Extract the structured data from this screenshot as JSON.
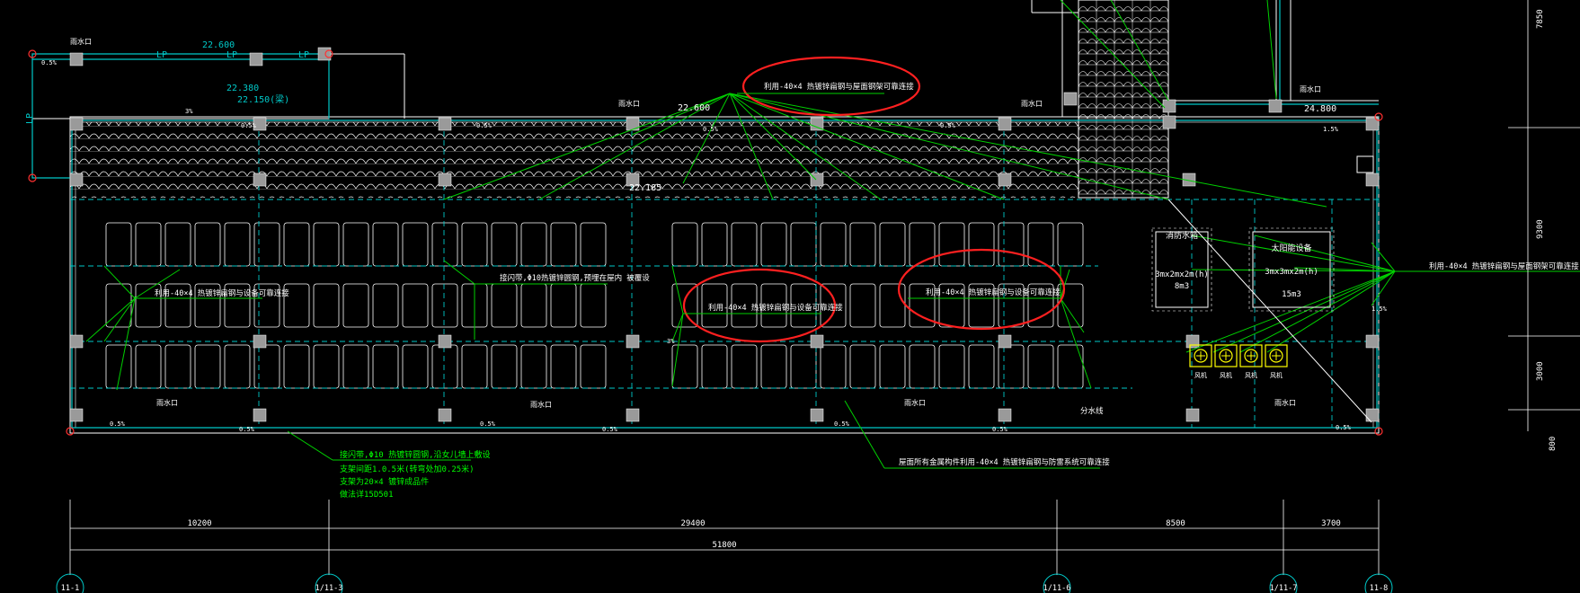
{
  "colors": {
    "background": "#000000",
    "structure": "#ffffff",
    "axis": "#00c8c8",
    "ground_wire": "#00ff00",
    "highlight_ellipse": "#ff2020",
    "equipment": "#ffff00",
    "column": "#9a9a9a"
  },
  "elevations": {
    "top_left": "22.600",
    "top_left_2": "22.380",
    "top_left_3": "22.150(梁)",
    "roof_center": "22.600",
    "roof_right": "24.800",
    "inner": "22.185"
  },
  "slope_labels": [
    "0.5%",
    "0.5%",
    "0.5%",
    "0.5%",
    "0.5%",
    "1.5%",
    "3%",
    "3%",
    "0.5%",
    "0.5%",
    "0.5%",
    "0.5%",
    "0.5%",
    "0.5%",
    "1.5%",
    "0.5%"
  ],
  "rain_outlet_label": "雨水口",
  "pipe_label": "LP",
  "notes": {
    "top_ellipse": "利用-40×4 热镀锌扁钢与屋面钢架可靠连接",
    "left_bay": "利用-40×4 热镀锌扁钢与设备可靠连接",
    "middle_bay": "接闪带,Φ10热镀锌圆钢,预埋在屋内 被覆设",
    "center_ellipse": "利用-40×4 热镀锌扁钢与设备可靠连接",
    "right_ellipse": "利用-40×4 热镀锌扁钢与设备可靠连接",
    "right_side": "利用-40×4 热镀锌扁钢与屋面钢架可靠连接",
    "bottom_right": "屋面所有金属构件利用-40×4 热镀锌扁钢与防雷系统可靠连接",
    "small_mark": "分水线"
  },
  "legend_notes": [
    "接闪带,Φ10 热镀锌圆钢,沿女儿墙上敷设",
    "支架间距1.0.5米(转弯处加0.25米)",
    "支架为20×4 镀锌成品件",
    "做法详15D501"
  ],
  "tanks": [
    {
      "title": "消防水箱",
      "size": "3mx2mx2m(h)",
      "volume": "8m3"
    },
    {
      "title": "太阳能设备",
      "size": "3mx3mx2m(h)",
      "volume": "15m3"
    }
  ],
  "dimensions": {
    "seg1": "10200",
    "seg2": "29400",
    "seg3": "8500",
    "seg4": "3700",
    "total": "51800",
    "v1": "7850",
    "v2": "9300",
    "v3": "3000",
    "v4": "800"
  },
  "grid_axes": [
    "11-1",
    "1/11-3",
    "1/11-6",
    "1/11-7",
    "11-8"
  ],
  "fan_label": "风机"
}
